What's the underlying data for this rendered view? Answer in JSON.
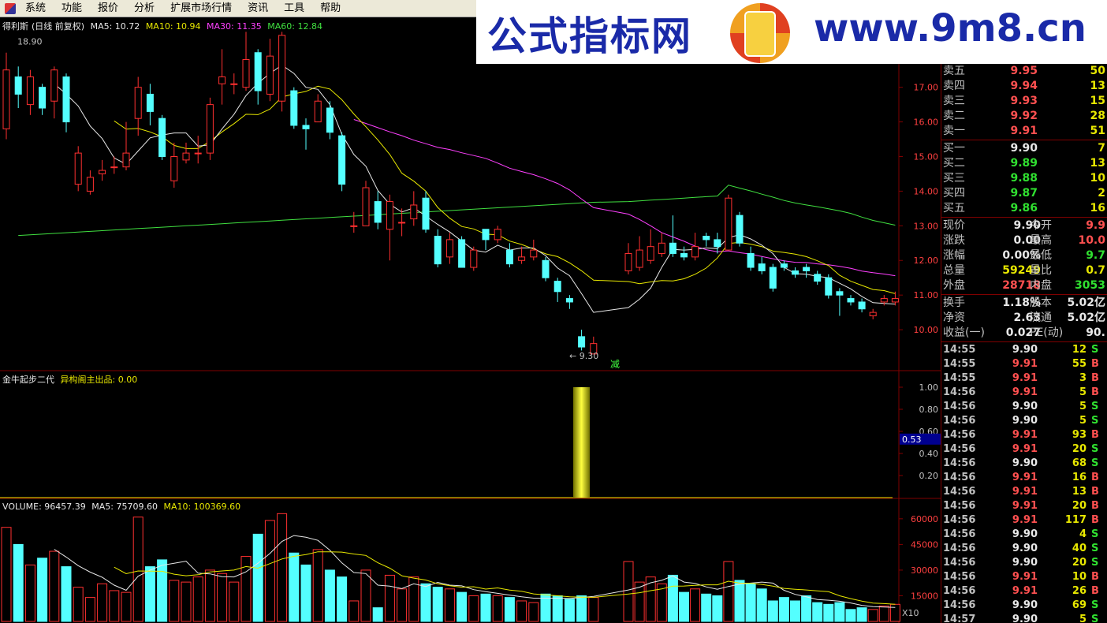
{
  "menubar": {
    "items": [
      "系统",
      "功能",
      "报价",
      "分析",
      "扩展市场行情",
      "资讯",
      "工具",
      "帮助"
    ]
  },
  "watermark": {
    "title": "公式指标网",
    "url": "www.9m8.cn",
    "logo_icon": "seal-logo-icon"
  },
  "main_legend": {
    "name": "得利斯",
    "mode": "(日线 前复权)",
    "ma5": "MA5: 10.72",
    "ma10": "MA10: 10.94",
    "ma30": "MA30: 11.35",
    "ma60": "MA60: 12.84"
  },
  "main_chart": {
    "high_label": "18.90",
    "low_label": "9.30",
    "reduce_label": "减",
    "price_ticks": [
      "18.00",
      "17.00",
      "16.00",
      "15.00",
      "14.00",
      "13.00",
      "12.00",
      "11.00",
      "10.00"
    ],
    "colors": {
      "up": "#ff3030",
      "down": "#54ffff",
      "ma5": "#e8e8e8",
      "ma10": "#e8e800",
      "ma30": "#ff40ff",
      "ma60": "#40e040"
    }
  },
  "indicator": {
    "name": "金牛起步二代",
    "sub": "异构阁主出品",
    "value": ": 0.00",
    "ticks": [
      "1.00",
      "0.80",
      "0.60",
      "0.40",
      "0.20"
    ],
    "current": "0.53"
  },
  "volume_legend": {
    "volume": "VOLUME: 96457.39",
    "ma5": "MA5: 75709.60",
    "ma10": "MA10: 100369.60"
  },
  "volume_chart": {
    "ticks": [
      "60000",
      "45000",
      "30000",
      "15000"
    ],
    "unit": "X10"
  },
  "order_book": {
    "asks": [
      {
        "label": "卖五",
        "price": "9.95",
        "vol": "50"
      },
      {
        "label": "卖四",
        "price": "9.94",
        "vol": "13"
      },
      {
        "label": "卖三",
        "price": "9.93",
        "vol": "15"
      },
      {
        "label": "卖二",
        "price": "9.92",
        "vol": "28"
      },
      {
        "label": "卖一",
        "price": "9.91",
        "vol": "51"
      }
    ],
    "bids": [
      {
        "label": "买一",
        "price": "9.90",
        "vol": "7"
      },
      {
        "label": "买二",
        "price": "9.89",
        "vol": "13"
      },
      {
        "label": "买三",
        "price": "9.88",
        "vol": "10"
      },
      {
        "label": "买四",
        "price": "9.87",
        "vol": "2"
      },
      {
        "label": "买五",
        "price": "9.86",
        "vol": "16"
      }
    ]
  },
  "quote": {
    "rows1": [
      {
        "l1": "现价",
        "v1": "9.90",
        "c1": "white",
        "l2": "今开",
        "v2": "9.9",
        "c2": "red"
      },
      {
        "l1": "涨跌",
        "v1": "0.00",
        "c1": "white",
        "l2": "最高",
        "v2": "10.0",
        "c2": "red"
      },
      {
        "l1": "涨幅",
        "v1": "0.00%",
        "c1": "white",
        "l2": "最低",
        "v2": "9.7",
        "c2": "green"
      },
      {
        "l1": "总量",
        "v1": "59249",
        "c1": "yellow",
        "l2": "量比",
        "v2": "0.7",
        "c2": "yellow"
      },
      {
        "l1": "外盘",
        "v1": "28718",
        "c1": "red",
        "l2": "内盘",
        "v2": "3053",
        "c2": "green"
      }
    ],
    "rows2": [
      {
        "l1": "换手",
        "v1": "1.18%",
        "c1": "white",
        "l2": "股本",
        "v2": "5.02亿",
        "c2": "white"
      },
      {
        "l1": "净资",
        "v1": "2.63",
        "c1": "white",
        "l2": "流通",
        "v2": "5.02亿",
        "c2": "white"
      },
      {
        "l1": "收益(一)",
        "v1": "0.027",
        "c1": "white",
        "l2": "PE(动)",
        "v2": "90.",
        "c2": "white"
      }
    ]
  },
  "ticks": [
    {
      "t": "14:55",
      "p": "9.90",
      "pc": "white",
      "v": "12",
      "d": "S"
    },
    {
      "t": "14:55",
      "p": "9.91",
      "pc": "red",
      "v": "55",
      "d": "B"
    },
    {
      "t": "14:55",
      "p": "9.91",
      "pc": "red",
      "v": "3",
      "d": "B"
    },
    {
      "t": "14:56",
      "p": "9.91",
      "pc": "red",
      "v": "5",
      "d": "B"
    },
    {
      "t": "14:56",
      "p": "9.90",
      "pc": "white",
      "v": "5",
      "d": "S"
    },
    {
      "t": "14:56",
      "p": "9.90",
      "pc": "white",
      "v": "5",
      "d": "S"
    },
    {
      "t": "14:56",
      "p": "9.91",
      "pc": "red",
      "v": "93",
      "d": "B"
    },
    {
      "t": "14:56",
      "p": "9.91",
      "pc": "red",
      "v": "20",
      "d": "S"
    },
    {
      "t": "14:56",
      "p": "9.90",
      "pc": "white",
      "v": "68",
      "d": "S"
    },
    {
      "t": "14:56",
      "p": "9.91",
      "pc": "red",
      "v": "16",
      "d": "B"
    },
    {
      "t": "14:56",
      "p": "9.91",
      "pc": "red",
      "v": "13",
      "d": "B"
    },
    {
      "t": "14:56",
      "p": "9.91",
      "pc": "red",
      "v": "20",
      "d": "B"
    },
    {
      "t": "14:56",
      "p": "9.91",
      "pc": "red",
      "v": "117",
      "d": "B"
    },
    {
      "t": "14:56",
      "p": "9.90",
      "pc": "white",
      "v": "4",
      "d": "S"
    },
    {
      "t": "14:56",
      "p": "9.90",
      "pc": "white",
      "v": "40",
      "d": "S"
    },
    {
      "t": "14:56",
      "p": "9.90",
      "pc": "white",
      "v": "20",
      "d": "S"
    },
    {
      "t": "14:56",
      "p": "9.91",
      "pc": "red",
      "v": "10",
      "d": "B"
    },
    {
      "t": "14:56",
      "p": "9.91",
      "pc": "red",
      "v": "26",
      "d": "B"
    },
    {
      "t": "14:56",
      "p": "9.90",
      "pc": "white",
      "v": "69",
      "d": "S"
    },
    {
      "t": "14:57",
      "p": "9.90",
      "pc": "white",
      "v": "5",
      "d": "S"
    }
  ],
  "chart_data": {
    "type": "candlestick",
    "price_ylim": [
      9.0,
      18.7
    ],
    "volume_ylim": [
      0,
      65000
    ],
    "candles": [
      [
        15.8,
        17.5,
        18.0,
        15.5,
        55000
      ],
      [
        17.3,
        16.8,
        17.6,
        16.4,
        45000
      ],
      [
        16.5,
        17.3,
        17.5,
        16.2,
        33000
      ],
      [
        17.0,
        16.4,
        17.1,
        16.2,
        37000
      ],
      [
        16.6,
        17.5,
        17.6,
        16.1,
        41000
      ],
      [
        17.3,
        16.0,
        17.4,
        15.7,
        32000
      ],
      [
        14.2,
        15.1,
        15.3,
        14.0,
        20000
      ],
      [
        14.0,
        14.4,
        14.6,
        13.9,
        14000
      ],
      [
        14.5,
        14.6,
        14.9,
        14.3,
        22000
      ],
      [
        14.7,
        14.7,
        15.0,
        14.5,
        18000
      ],
      [
        14.7,
        15.1,
        16.0,
        14.6,
        17000
      ],
      [
        16.1,
        17.0,
        17.3,
        15.6,
        61000
      ],
      [
        16.8,
        16.3,
        17.1,
        15.9,
        32000
      ],
      [
        16.1,
        15.0,
        16.2,
        14.9,
        36000
      ],
      [
        14.3,
        15.0,
        15.4,
        14.1,
        24000
      ],
      [
        14.9,
        15.1,
        15.4,
        14.8,
        23000
      ],
      [
        15.1,
        15.1,
        15.6,
        14.8,
        26000
      ],
      [
        15.1,
        16.5,
        16.7,
        14.9,
        30000
      ],
      [
        17.1,
        17.3,
        18.1,
        16.5,
        28000
      ],
      [
        17.1,
        17.1,
        17.4,
        16.8,
        23000
      ],
      [
        17.0,
        17.8,
        18.6,
        16.9,
        38000
      ],
      [
        18.0,
        16.9,
        18.1,
        16.5,
        51000
      ],
      [
        16.8,
        17.9,
        18.4,
        16.6,
        59000
      ],
      [
        16.6,
        18.5,
        18.6,
        16.3,
        63000
      ],
      [
        16.9,
        15.9,
        17.0,
        15.8,
        40000
      ],
      [
        15.9,
        15.8,
        16.1,
        15.2,
        33000
      ],
      [
        16.0,
        16.6,
        16.8,
        16.0,
        42000
      ],
      [
        16.4,
        15.7,
        16.6,
        15.5,
        30000
      ],
      [
        15.6,
        14.2,
        15.7,
        14.0,
        26000
      ],
      [
        13.0,
        13.0,
        13.4,
        12.8,
        12000
      ],
      [
        13.0,
        14.1,
        14.3,
        13.0,
        30000
      ],
      [
        13.7,
        13.1,
        14.0,
        12.9,
        8000
      ],
      [
        12.9,
        13.7,
        13.9,
        12.0,
        27000
      ],
      [
        13.1,
        13.1,
        13.5,
        12.7,
        19000
      ],
      [
        13.2,
        13.6,
        14.0,
        13.0,
        26000
      ],
      [
        13.8,
        12.9,
        14.0,
        12.8,
        22000
      ],
      [
        12.7,
        11.9,
        12.9,
        11.8,
        20000
      ],
      [
        12.1,
        12.6,
        12.8,
        11.9,
        19000
      ],
      [
        12.6,
        11.8,
        12.7,
        11.8,
        17000
      ],
      [
        11.8,
        12.3,
        12.4,
        11.7,
        15000
      ],
      [
        12.9,
        12.6,
        12.9,
        12.3,
        16000
      ],
      [
        12.6,
        12.9,
        13.0,
        12.5,
        15000
      ],
      [
        12.3,
        11.9,
        12.5,
        11.8,
        14000
      ],
      [
        12.0,
        12.1,
        12.4,
        11.9,
        12000
      ],
      [
        12.1,
        12.3,
        12.6,
        12.0,
        11000
      ],
      [
        12.0,
        11.5,
        12.1,
        11.4,
        16000
      ],
      [
        11.4,
        11.1,
        11.5,
        10.8,
        15000
      ],
      [
        10.9,
        10.8,
        11.0,
        10.6,
        13000
      ],
      [
        9.8,
        9.5,
        10.0,
        9.4,
        15000
      ],
      [
        9.3,
        9.6,
        9.8,
        9.3,
        14000
      ]
    ],
    "candles2": [
      [
        11.7,
        12.2,
        12.5,
        11.6,
        35000
      ],
      [
        11.8,
        12.3,
        12.7,
        11.7,
        23000
      ],
      [
        12.0,
        12.4,
        12.9,
        11.9,
        26000
      ],
      [
        12.2,
        12.5,
        12.8,
        12.1,
        22000
      ],
      [
        12.5,
        12.2,
        13.3,
        12.1,
        27000
      ],
      [
        12.2,
        12.1,
        12.4,
        12.0,
        17000
      ],
      [
        12.1,
        12.4,
        12.8,
        12.0,
        19000
      ],
      [
        12.7,
        12.6,
        12.8,
        12.4,
        16000
      ],
      [
        12.6,
        12.4,
        12.8,
        12.2,
        15000
      ],
      [
        12.3,
        13.8,
        13.9,
        12.3,
        35000
      ],
      [
        13.3,
        12.5,
        13.4,
        12.4,
        24000
      ],
      [
        12.2,
        11.8,
        12.4,
        11.7,
        22000
      ],
      [
        11.9,
        11.7,
        12.1,
        11.6,
        19000
      ],
      [
        11.8,
        11.2,
        11.9,
        11.1,
        12000
      ],
      [
        11.9,
        11.8,
        12.0,
        11.7,
        14000
      ],
      [
        11.7,
        11.6,
        11.8,
        11.5,
        12000
      ],
      [
        11.8,
        11.7,
        11.9,
        11.5,
        15000
      ],
      [
        11.6,
        11.4,
        11.7,
        11.3,
        11000
      ],
      [
        11.5,
        11.0,
        11.6,
        10.9,
        10000
      ],
      [
        11.1,
        11.0,
        11.2,
        10.4,
        11000
      ],
      [
        10.9,
        10.8,
        11.0,
        10.7,
        7000
      ],
      [
        10.8,
        10.6,
        10.9,
        10.5,
        8000
      ],
      [
        10.4,
        10.5,
        10.6,
        10.3,
        7000
      ],
      [
        10.8,
        10.9,
        11.0,
        10.7,
        9000
      ],
      [
        10.8,
        10.9,
        11.1,
        10.7,
        10000
      ]
    ],
    "indicator_signal_index": 49,
    "indicator_value": 1.0
  }
}
